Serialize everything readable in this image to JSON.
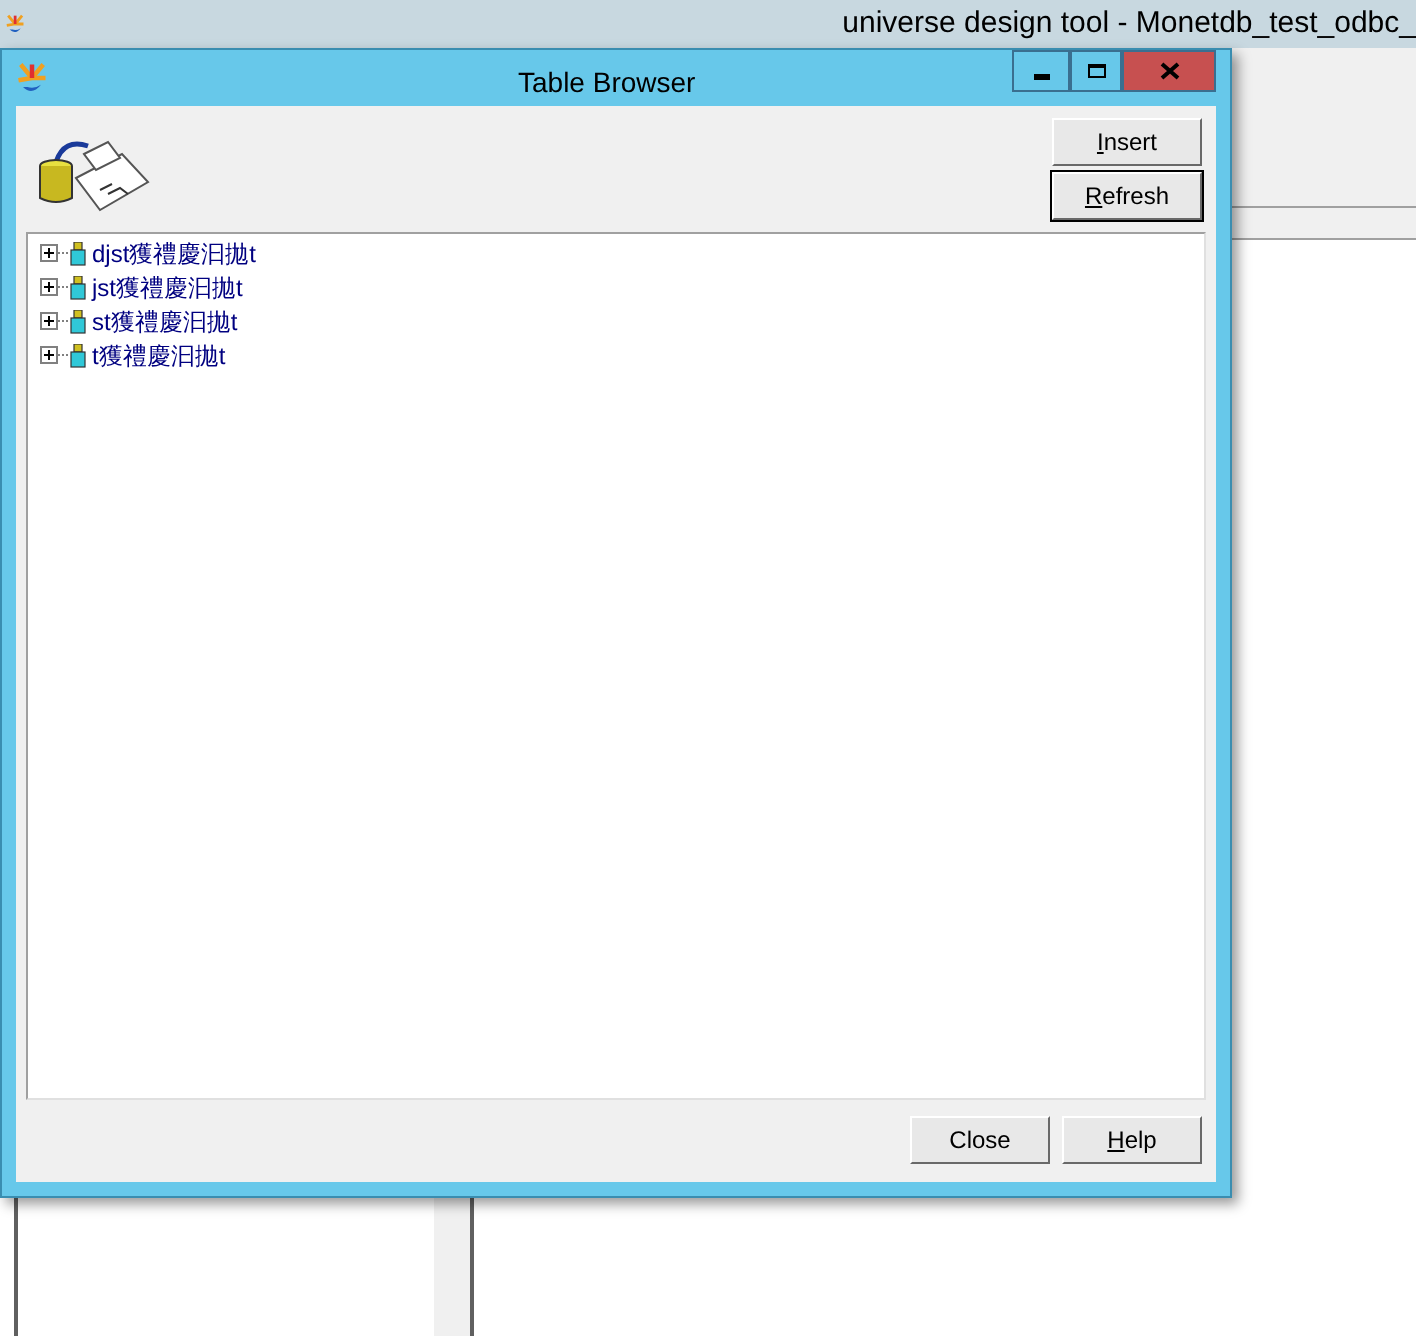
{
  "app_window": {
    "title": "universe design tool - Monetdb_test_odbc_"
  },
  "dialog": {
    "title": "Table Browser",
    "buttons_top": [
      {
        "label": "Insert",
        "first_letter_underlined": true,
        "focused": false
      },
      {
        "label": "Refresh",
        "first_letter_underlined": true,
        "focused": true
      }
    ],
    "tree": [
      {
        "label": "djst獲禮慶汩拋t",
        "expanded": false
      },
      {
        "label": "jst獲禮慶汩拋t",
        "expanded": false
      },
      {
        "label": "st獲禮慶汩拋t",
        "expanded": false
      },
      {
        "label": "t獲禮慶汩拋t",
        "expanded": false
      }
    ],
    "buttons_bottom": [
      {
        "label": "Close",
        "first_letter_underlined": false,
        "focused": false
      },
      {
        "label": "Help",
        "first_letter_underlined": true,
        "focused": false
      }
    ]
  }
}
